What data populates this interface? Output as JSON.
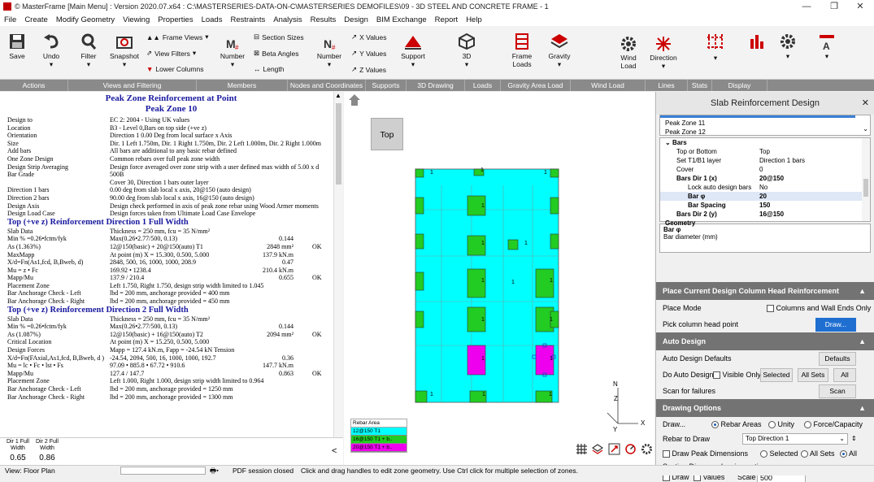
{
  "app": {
    "title": "© MasterFrame [Main Menu] : Version 2020.07.x64 : C:\\MASTERSERIES-DATA-ON-C\\MASTERSERIES DEMOFILES\\09 - 3D STEEL AND CONCRETE FRAME - 1"
  },
  "window_controls": {
    "minimize": "—",
    "restore": "❐",
    "close": "✕"
  },
  "menu": [
    "File",
    "Create",
    "Modify Geometry",
    "Viewing",
    "Properties",
    "Loads",
    "Restraints",
    "Analysis",
    "Results",
    "Design",
    "BIM Exchange",
    "Report",
    "Help"
  ],
  "ribbon": {
    "save": "Save",
    "undo": "Undo",
    "filter": "Filter",
    "snapshot": "Snapshot",
    "frame_views": "Frame Views",
    "view_filters": "View Filters",
    "lower_columns": "Lower Columns",
    "number1": "Number",
    "section_sizes": "Section Sizes",
    "beta_angles": "Beta Angles",
    "length": "Length",
    "number2": "Number",
    "x_values": "X Values",
    "y_values": "Y Values",
    "z_values": "Z Values",
    "support": "Support",
    "threed": "3D",
    "frame_loads": "Frame Loads",
    "gravity": "Gravity",
    "wind_load": "Wind Load",
    "direction": "Direction",
    "groups": [
      {
        "label": "Actions",
        "w": 84
      },
      {
        "label": "Views and Filtering",
        "w": 158
      },
      {
        "label": "Members",
        "w": 112
      },
      {
        "label": "Nodes and Coordinates",
        "w": 96
      },
      {
        "label": "Supports",
        "w": 50
      },
      {
        "label": "3D Drawing",
        "w": 72
      },
      {
        "label": "Loads",
        "w": 44
      },
      {
        "label": "Gravity Area Load",
        "w": 86
      },
      {
        "label": "Wind Load",
        "w": 92
      },
      {
        "label": "Lines",
        "w": 52
      },
      {
        "label": "Stats",
        "w": 30
      },
      {
        "label": "Display",
        "w": 68
      }
    ]
  },
  "report": {
    "title": "Peak Zone Reinforcement at Point",
    "subtitle": "Peak Zone 10",
    "rows1": [
      [
        "Design to",
        "EC 2: 2004 - Using UK values"
      ],
      [
        "Location",
        "B3 - Level 0,Bars on top side (+ve z)"
      ],
      [
        "Orientation",
        "Direction 1 0.00 Deg from local surface x Axis"
      ],
      [
        "Size",
        "Dir. 1 Left 1.750m, Dir. 1 Right 1.750m, Dir. 2 Left 1.000m, Dir. 2 Right 1.000m"
      ],
      [
        "Add bars",
        "All bars are additional to any basic rebar defined"
      ],
      [
        "One Zone Design",
        "Common rebars over full peak zone width"
      ],
      [
        "Design Strip Averaging",
        "Design force averaged over zone strip with a user defined max width of 5.00 x d"
      ],
      [
        "Bar Grade",
        "500B"
      ],
      [
        "",
        "Cover 30, Direction 1 bars outer layer"
      ],
      [
        "Direction 1 bars",
        "0.00 deg from slab local x axis, 20@150 (auto design)"
      ],
      [
        "Direction 2 bars",
        "90.00 deg from slab local x axis, 16@150 (auto design)"
      ],
      [
        "Design Axis",
        "Design check performed in axis of peak zone rebar using Wood Armer moments"
      ],
      [
        "Design Load Case",
        "Design forces taken from Ultimate Load Case Envelope"
      ]
    ],
    "sec1": "Top (+ve z) Reinforcement Direction 1 Full Width",
    "rows2": [
      [
        "Slab Data",
        "Thickness = 250 mm, fcu = 35 N/mm²",
        "",
        ""
      ],
      [
        "Min % =0.26•fctm/fyk",
        "Max(0.26•2.77/500, 0.13)",
        "0.144",
        ""
      ],
      [
        "As (1.363%)",
        "12@150(basic) + 20@150(auto) T1",
        "2848 mm²",
        "OK"
      ],
      [
        "MaxMapp",
        "At point (m) X = 15.300, 0.500, 5.000",
        "137.9 kN.m",
        ""
      ],
      [
        "X/d=Fn(As1,fcd, B,Bweb, d)",
        "2848, 500, 16, 1000, 1000, 208.9",
        "0.47",
        ""
      ],
      [
        "Mu = z • Fc",
        "169.92 • 1238.4",
        "210.4 kN.m",
        ""
      ],
      [
        "Mapp/Mu",
        "137.9 / 210.4",
        "0.655",
        "OK"
      ],
      [
        "Placement Zone",
        "Left 1.750, Right 1.750, design strip width limited to 1.045",
        "",
        ""
      ],
      [
        "Bar Anchorage Check - Left",
        "lbd = 200 mm, anchorage provided = 400 mm",
        "",
        ""
      ],
      [
        "Bar Anchorage Check - Right",
        "lbd = 200 mm, anchorage provided = 450 mm",
        "",
        ""
      ]
    ],
    "sec2": "Top (+ve z) Reinforcement Direction 2 Full Width",
    "rows3": [
      [
        "Slab Data",
        "Thickness = 250 mm, fcu = 35 N/mm²",
        "",
        ""
      ],
      [
        "Min % =0.26•fctm/fyk",
        "Max(0.26•2.77/500, 0.13)",
        "0.144",
        ""
      ],
      [
        "As (1.087%)",
        "12@150(basic) + 16@150(auto) T2",
        "2094 mm²",
        "OK"
      ],
      [
        "Critical Location",
        "At point (m) X = 15.250, 0.500, 5.000",
        "",
        ""
      ],
      [
        "Design Forces",
        "Mapp = 127.4 kN.m, Fapp = -24.54 kN Tension",
        "",
        ""
      ],
      [
        "X/d=Fn(FAxial,As1,fcd, B,Bweb, d )",
        "-24.54, 2094, 500, 16, 1000, 1000, 192.7",
        "0.36",
        ""
      ],
      [
        "Mu = lc • Fc • lst • Fs",
        "97.09 • 885.8 • 67.72 • 910.6",
        "147.7 kN.m",
        ""
      ],
      [
        "Mapp/Mu",
        "127.4 / 147.7",
        "0.863",
        "OK"
      ],
      [
        "Placement Zone",
        "Left 1.000, Right 1.000, design strip width limited to 0.964",
        "",
        ""
      ],
      [
        "Bar Anchorage Check - Left",
        "lbd = 200 mm, anchorage provided = 1250 mm",
        "",
        ""
      ],
      [
        "Bar Anchorage Check - Right",
        "lbd = 200 mm, anchorage provided = 1300 mm",
        "",
        ""
      ]
    ]
  },
  "bottom_ratios": [
    {
      "l1": "Dir 1 Full",
      "l2": "Width",
      "v": "0.65"
    },
    {
      "l1": "Dir 2 Full",
      "l2": "Width",
      "v": "0.86"
    }
  ],
  "bottom_arrow": "<",
  "canvas": {
    "top_button": "Top",
    "legend_title": "Rebar Area",
    "legend": [
      {
        "label": "12@150 T1",
        "color": "#00ffff"
      },
      {
        "label": "16@150 T1 + b..",
        "color": "#22cc22"
      },
      {
        "label": "20@150 T1 + b..",
        "color": "#ee00ee"
      }
    ],
    "axis_n": "N",
    "axis_z": "Z",
    "axis_y": "Y",
    "axis_x": "X"
  },
  "panel": {
    "title": "Slab Reinforcement Design",
    "close": "✕",
    "list": [
      "Peak Zone 11",
      "Peak Zone 12"
    ],
    "bars_header": "Bars",
    "props": [
      {
        "k": "Top or Bottom",
        "v": "Top",
        "bold": false,
        "indent": 1
      },
      {
        "k": "Set T1/B1 layer",
        "v": "Direction 1 bars",
        "bold": false,
        "indent": 1
      },
      {
        "k": "Cover",
        "v": "0",
        "bold": false,
        "indent": 1
      },
      {
        "k": "Bars Dir 1 (x)",
        "v": "20@150",
        "bold": true,
        "indent": 1
      },
      {
        "k": "Lock auto design bars",
        "v": "No",
        "bold": false,
        "indent": 2
      },
      {
        "k": "Bar φ",
        "v": "20",
        "bold": true,
        "indent": 2
      },
      {
        "k": "Bar Spacing",
        "v": "150",
        "bold": true,
        "indent": 2
      },
      {
        "k": "Bars Dir 2 (y)",
        "v": "16@150",
        "bold": true,
        "indent": 1
      },
      {
        "k": "Geometry",
        "v": "",
        "bold": true,
        "indent": 0
      }
    ],
    "desc_title": "Bar φ",
    "desc_text": "Bar diameter (mm)",
    "s1": "Place Current Design Column Head Reinforcement",
    "place_mode": "Place Mode",
    "cols_walls": "Columns and Wall Ends Only",
    "pick_col": "Pick column head point",
    "draw_btn": "Draw...",
    "s2": "Auto Design",
    "auto_defaults": "Auto Design Defaults",
    "defaults_btn": "Defaults",
    "do_auto": "Do Auto Design",
    "visible_only": "Visible Only",
    "selected_btn": "Selected",
    "allsets_btn": "All Sets",
    "all_btn": "All",
    "scan_fail": "Scan for failures",
    "scan_btn": "Scan",
    "s3": "Drawing Options",
    "draw_lbl": "Draw...",
    "rebar_areas": "Rebar Areas",
    "unity": "Unity",
    "force_cap": "Force/Capacity",
    "rebar_to_draw": "Rebar to Draw",
    "rebar_sel": "Top Direction 1",
    "draw_peak": "Draw Peak Dimensions",
    "selected_r": "Selected",
    "allsets_r": "All Sets",
    "all_r": "All",
    "section_opts": "Section Diagram drawing options",
    "draw_cb": "Draw",
    "values_cb": "Values",
    "scale_lbl": "Scale",
    "scale_val": "500"
  },
  "status": {
    "view": "View: Floor Plan",
    "pdf": "PDF session closed",
    "msg": "Click and drag handles to edit zone geometry. Use Ctrl click for multiple selection of zones."
  }
}
